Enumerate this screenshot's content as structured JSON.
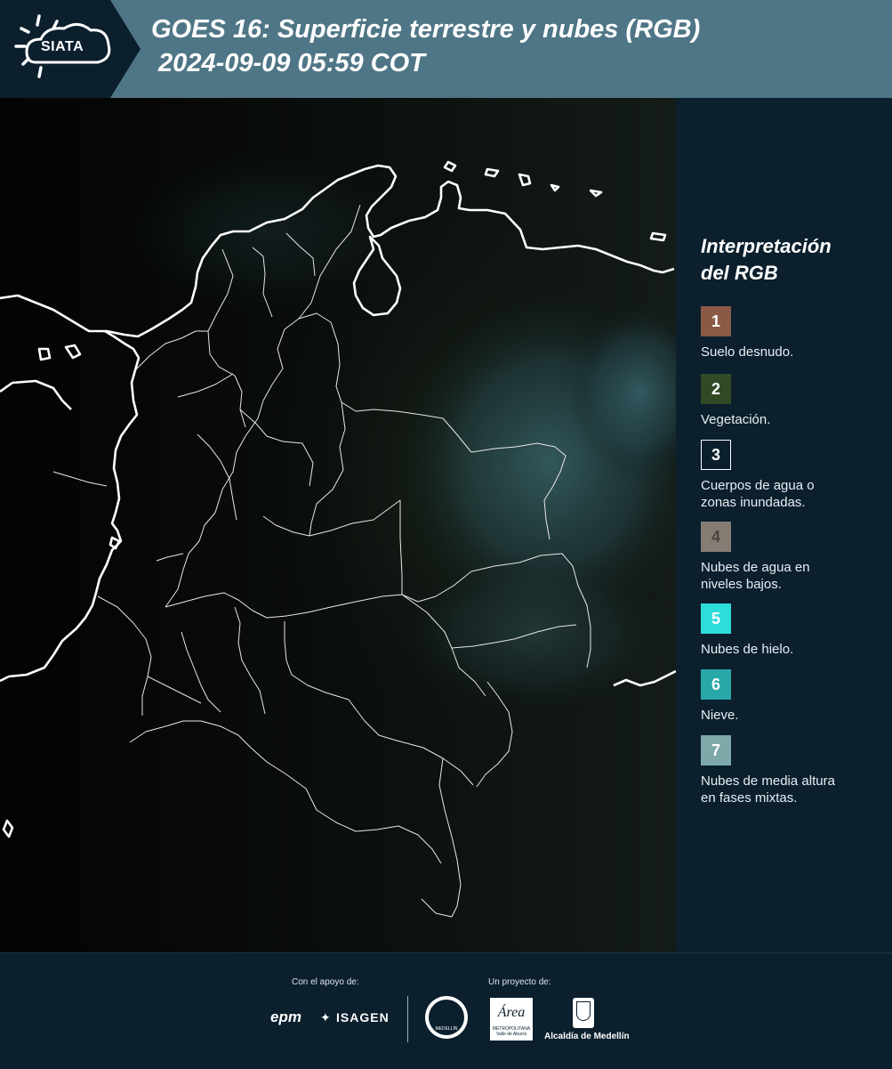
{
  "header": {
    "logo_text": "SIATA",
    "title_line1": "GOES 16: Superficie terrestre y nubes (RGB)",
    "title_line2": " 2024-09-09 05:59 COT"
  },
  "legend": {
    "title_line1": "Interpretación",
    "title_line2": "del RGB",
    "items": [
      {
        "number": "1",
        "label_line1": "Suelo desnudo.",
        "label_line2": "",
        "color": "#8a5a46"
      },
      {
        "number": "2",
        "label_line1": "Vegetación.",
        "label_line2": "",
        "color": "#2f4a25"
      },
      {
        "number": "3",
        "label_line1": "Cuerpos de agua o",
        "label_line2": "zonas inundadas.",
        "color": "#0b1f2d"
      },
      {
        "number": "4",
        "label_line1": "Nubes de agua en",
        "label_line2": "niveles bajos.",
        "color": "#857d74"
      },
      {
        "number": "5",
        "label_line1": "Nubes de hielo.",
        "label_line2": "",
        "color": "#2fdcdc"
      },
      {
        "number": "6",
        "label_line1": "Nieve.",
        "label_line2": "",
        "color": "#28a8a8"
      },
      {
        "number": "7",
        "label_line1": "Nubes de media altura",
        "label_line2": "en fases mixtas.",
        "color": "#7fa8aa"
      }
    ]
  },
  "footer": {
    "support_label": "Con el apoyo de:",
    "project_label": "Un proyecto de:",
    "sponsor_epm": "epm",
    "sponsor_isagen": "ISAGEN",
    "area_logo_text": "Área",
    "area_logo_sub1": "METROPOLITANA",
    "area_logo_sub2": "Valle de Aburrá",
    "alcaldia_label": "Alcaldía de Medellín",
    "seal_text": "MEDELLÍN"
  }
}
